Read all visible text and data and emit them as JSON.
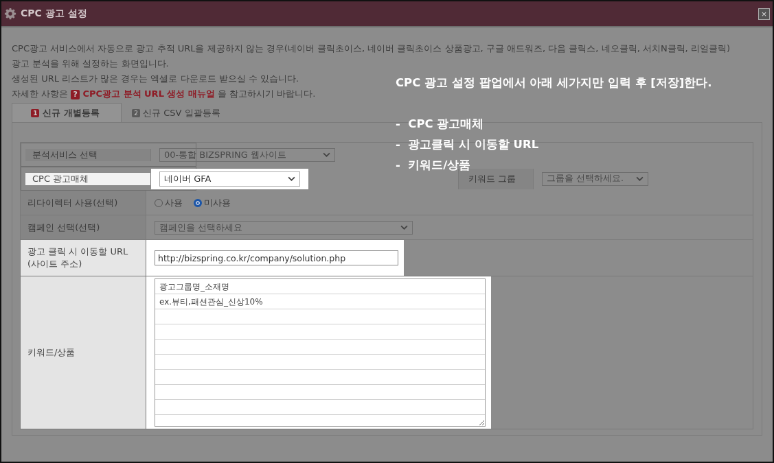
{
  "window": {
    "title": "CPC 광고 설정",
    "close": "×"
  },
  "intro": {
    "lines": [
      "CPC광고 서비스에서 자동으로 광고 추적 URL을 제공하지 않는 경우(네이버 클릭초이스, 네이버 클릭초이스 상품광고, 구글 애드워즈, 다음 클릭스, 네오클릭, 서치N클릭, 리얼클릭)",
      "광고 분석을 위해 설정하는 화면입니다.",
      "생성된 URL 리스트가 많은 경우는 엑셀로 다운로드 받으실 수 있습니다."
    ],
    "help": {
      "before": "자세한 사항은",
      "badge": "?",
      "link": "CPC광고 분석 URL 생성 매뉴얼",
      "after": "을 참고하시기 바랍니다."
    }
  },
  "tabs": [
    {
      "badge": "1",
      "label": "신규 개별등록",
      "selected": true
    },
    {
      "badge": "2",
      "label": "신규 CSV 일괄등록",
      "selected": false
    }
  ],
  "rows": [
    {
      "kind": "select",
      "label": "분석서비스 선택",
      "value": "00-통합 BIZSPRING 웹사이트",
      "highlighted": false
    },
    {
      "kind": "select",
      "label": "CPC 광고매체",
      "value": "네이버 GFA",
      "highlighted": true,
      "group": {
        "label": "키워드 그룹",
        "value": "그룹을 선택하세요."
      }
    },
    {
      "kind": "radio",
      "label": "리다이렉터 사용(선택)",
      "highlighted": false,
      "options": [
        {
          "label": "사용",
          "selected": false
        },
        {
          "label": "미사용",
          "selected": true
        }
      ]
    },
    {
      "kind": "wide-select",
      "label": "캠페인 선택(선택)",
      "value": "캠페인을 선택하세요",
      "highlighted": false
    },
    {
      "kind": "url",
      "label_lines": [
        "광고 클릭 시 이동할 URL",
        "(사이트 주소)"
      ],
      "value": "http://bizspring.co.kr/company/solution.php",
      "highlighted": true
    },
    {
      "kind": "textarea",
      "label": "키워드/상품",
      "lines": [
        "광고그룹명_소재명",
        "ex.뷰티,패션관심_신상10%"
      ],
      "highlighted": true
    }
  ],
  "annotation": {
    "title": "CPC 광고 설정 팝업에서 아래 세가지만 입력 후 [저장]한다.",
    "items": [
      {
        "bullet": "-",
        "text": "CPC 광고매체"
      },
      {
        "bullet": "-",
        "text": "광고클릭 시 이동할 URL"
      },
      {
        "bullet": "-",
        "text": "키워드/상품"
      }
    ]
  }
}
